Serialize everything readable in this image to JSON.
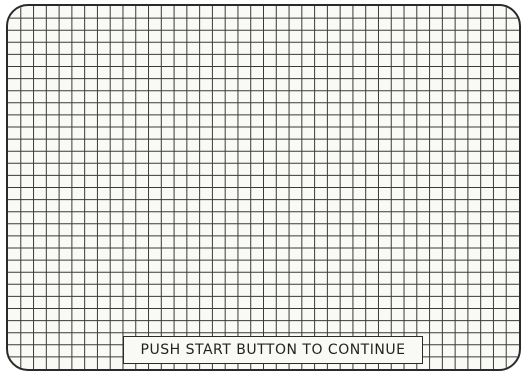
{
  "screen": {
    "prompt_text": "PUSH START BUTTON TO CONTINUE",
    "grid": {
      "columns": 40,
      "rows": 30,
      "line_color": "#3a3a3a",
      "background_color": "#f9f9f6"
    }
  }
}
